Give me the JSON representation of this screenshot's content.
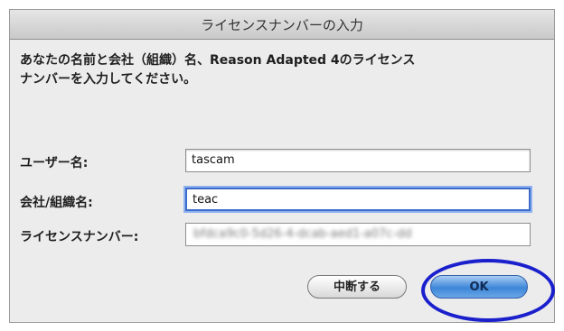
{
  "dialog": {
    "title": "ライセンスナンバーの入力",
    "message_line1": "あなたの名前と会社（組織）名、Reason Adapted 4のライセンス",
    "message_line2": "ナンバーを入力してください。"
  },
  "fields": {
    "user_name_label": "ユーザー名:",
    "user_name_value": "tascam",
    "company_label": "会社/組織名:",
    "company_value": "teac",
    "license_label": "ライセンスナンバー:",
    "license_value_obscured": "bfdca9c0-5d26-4-dcab-aed1-a07c-dd"
  },
  "buttons": {
    "cancel_label": "中断する",
    "ok_label": "OK"
  },
  "annotation": {
    "highlight_color": "#1a20cc"
  }
}
